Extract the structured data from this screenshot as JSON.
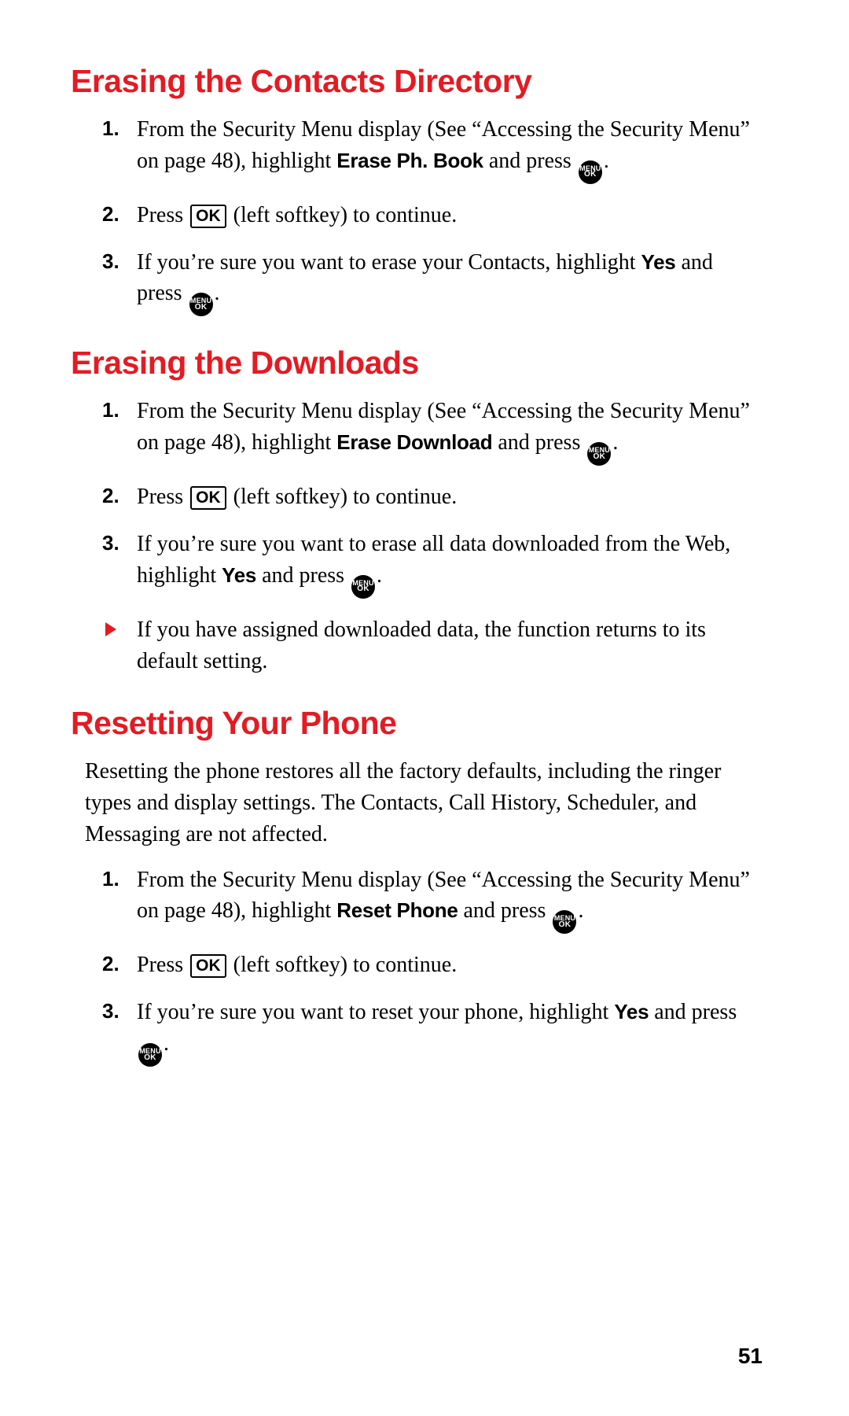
{
  "icons": {
    "menu_ok_top": "MENU",
    "menu_ok_bottom": "OK",
    "ok_key": "OK"
  },
  "page_number": "51",
  "sections": [
    {
      "heading": "Erasing the Contacts Directory",
      "steps": [
        {
          "num": "1.",
          "parts": [
            {
              "t": "text",
              "v": "From the Security Menu display (See “Accessing the Security Menu” on page 48), highlight "
            },
            {
              "t": "bold",
              "v": "Erase Ph. Book"
            },
            {
              "t": "text",
              "v": " and press "
            },
            {
              "t": "menuok"
            },
            {
              "t": "text",
              "v": "."
            }
          ]
        },
        {
          "num": "2.",
          "parts": [
            {
              "t": "text",
              "v": "Press "
            },
            {
              "t": "okkey"
            },
            {
              "t": "text",
              "v": " (left softkey) to continue."
            }
          ]
        },
        {
          "num": "3.",
          "parts": [
            {
              "t": "text",
              "v": "If you’re sure you want to erase your Contacts, highlight "
            },
            {
              "t": "bold",
              "v": "Yes"
            },
            {
              "t": "text",
              "v": " and press "
            },
            {
              "t": "menuok"
            },
            {
              "t": "text",
              "v": "."
            }
          ]
        }
      ]
    },
    {
      "heading": "Erasing the Downloads",
      "steps": [
        {
          "num": "1.",
          "parts": [
            {
              "t": "text",
              "v": "From the Security Menu display (See “Accessing the Security Menu” on page 48), highlight "
            },
            {
              "t": "bold",
              "v": "Erase Download"
            },
            {
              "t": "text",
              "v": " and press "
            },
            {
              "t": "menuok"
            },
            {
              "t": "text",
              "v": "."
            }
          ]
        },
        {
          "num": "2.",
          "parts": [
            {
              "t": "text",
              "v": "Press "
            },
            {
              "t": "okkey"
            },
            {
              "t": "text",
              "v": " (left softkey) to continue."
            }
          ]
        },
        {
          "num": "3.",
          "parts": [
            {
              "t": "text",
              "v": "If you’re sure you want to erase all data downloaded from the Web, highlight "
            },
            {
              "t": "bold",
              "v": "Yes"
            },
            {
              "t": "text",
              "v": " and press "
            },
            {
              "t": "menuok"
            },
            {
              "t": "text",
              "v": "."
            }
          ]
        }
      ],
      "notes": [
        {
          "parts": [
            {
              "t": "text",
              "v": "If you have assigned downloaded data, the function returns to its default setting."
            }
          ]
        }
      ]
    },
    {
      "heading": "Resetting Your Phone",
      "intro": "Resetting the phone restores all the factory defaults, including the ringer types and display settings. The Contacts, Call History, Scheduler, and Messaging are not affected.",
      "steps": [
        {
          "num": "1.",
          "parts": [
            {
              "t": "text",
              "v": "From the Security Menu display (See “Accessing the Security Menu” on page 48), highlight "
            },
            {
              "t": "bold",
              "v": "Reset Phone"
            },
            {
              "t": "text",
              "v": " and press "
            },
            {
              "t": "menuok"
            },
            {
              "t": "text",
              "v": "."
            }
          ]
        },
        {
          "num": "2.",
          "parts": [
            {
              "t": "text",
              "v": "Press "
            },
            {
              "t": "okkey"
            },
            {
              "t": "text",
              "v": " (left softkey) to continue."
            }
          ]
        },
        {
          "num": "3.",
          "parts": [
            {
              "t": "text",
              "v": "If you’re sure you want to reset your phone, highlight "
            },
            {
              "t": "bold",
              "v": "Yes"
            },
            {
              "t": "text",
              "v": " and press "
            },
            {
              "t": "menuok"
            },
            {
              "t": "text",
              "v": "."
            }
          ]
        }
      ]
    }
  ]
}
